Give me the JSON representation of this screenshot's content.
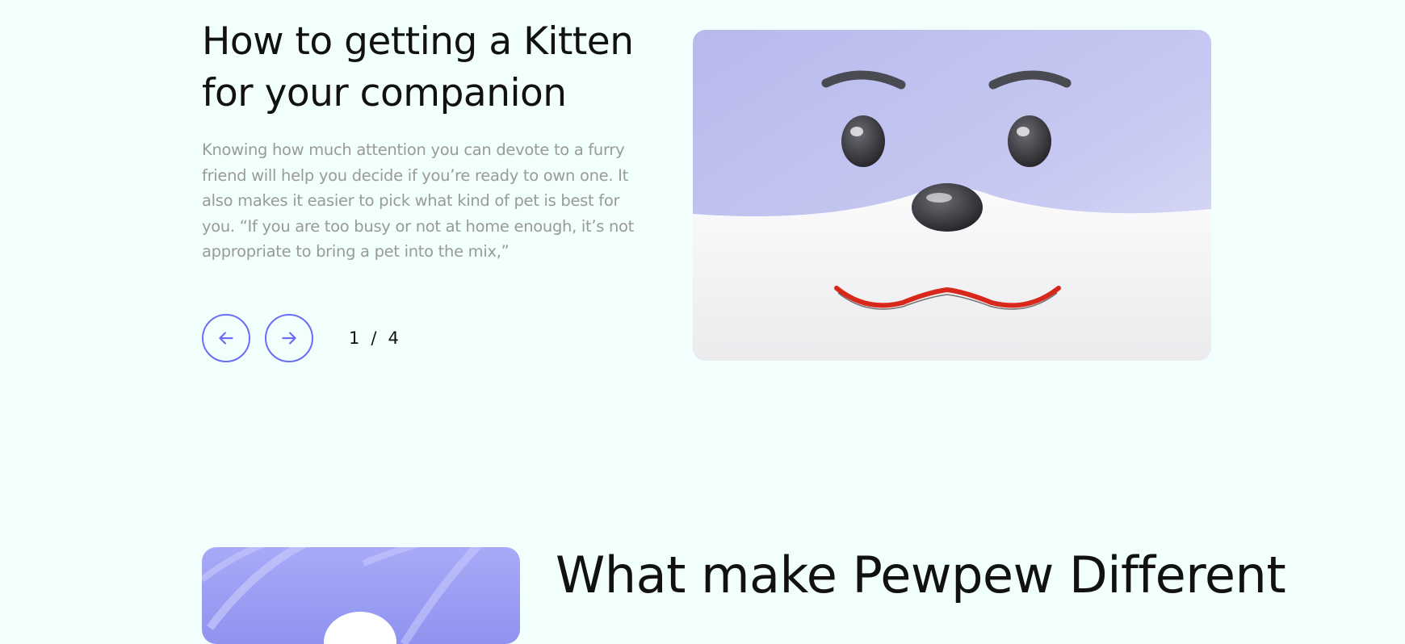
{
  "article": {
    "title": "How to getting a Kitten for your companion",
    "body": "Knowing how much attention you can devote to a furry friend will help you decide if you’re ready to own one. It also makes it easier to pick what kind of pet is best for you. “If you are too busy or not at home enough, it’s not appropriate to bring a pet into the mix,”"
  },
  "pager": {
    "current": "1",
    "separator": "/",
    "total": "4",
    "prev_icon": "arrow-left-icon",
    "next_icon": "arrow-right-icon"
  },
  "section": {
    "title": "What make Pewpew Different"
  },
  "colors": {
    "background": "#f1fffd",
    "accent": "#6a6df5",
    "muted_text": "#9a9a9a"
  }
}
